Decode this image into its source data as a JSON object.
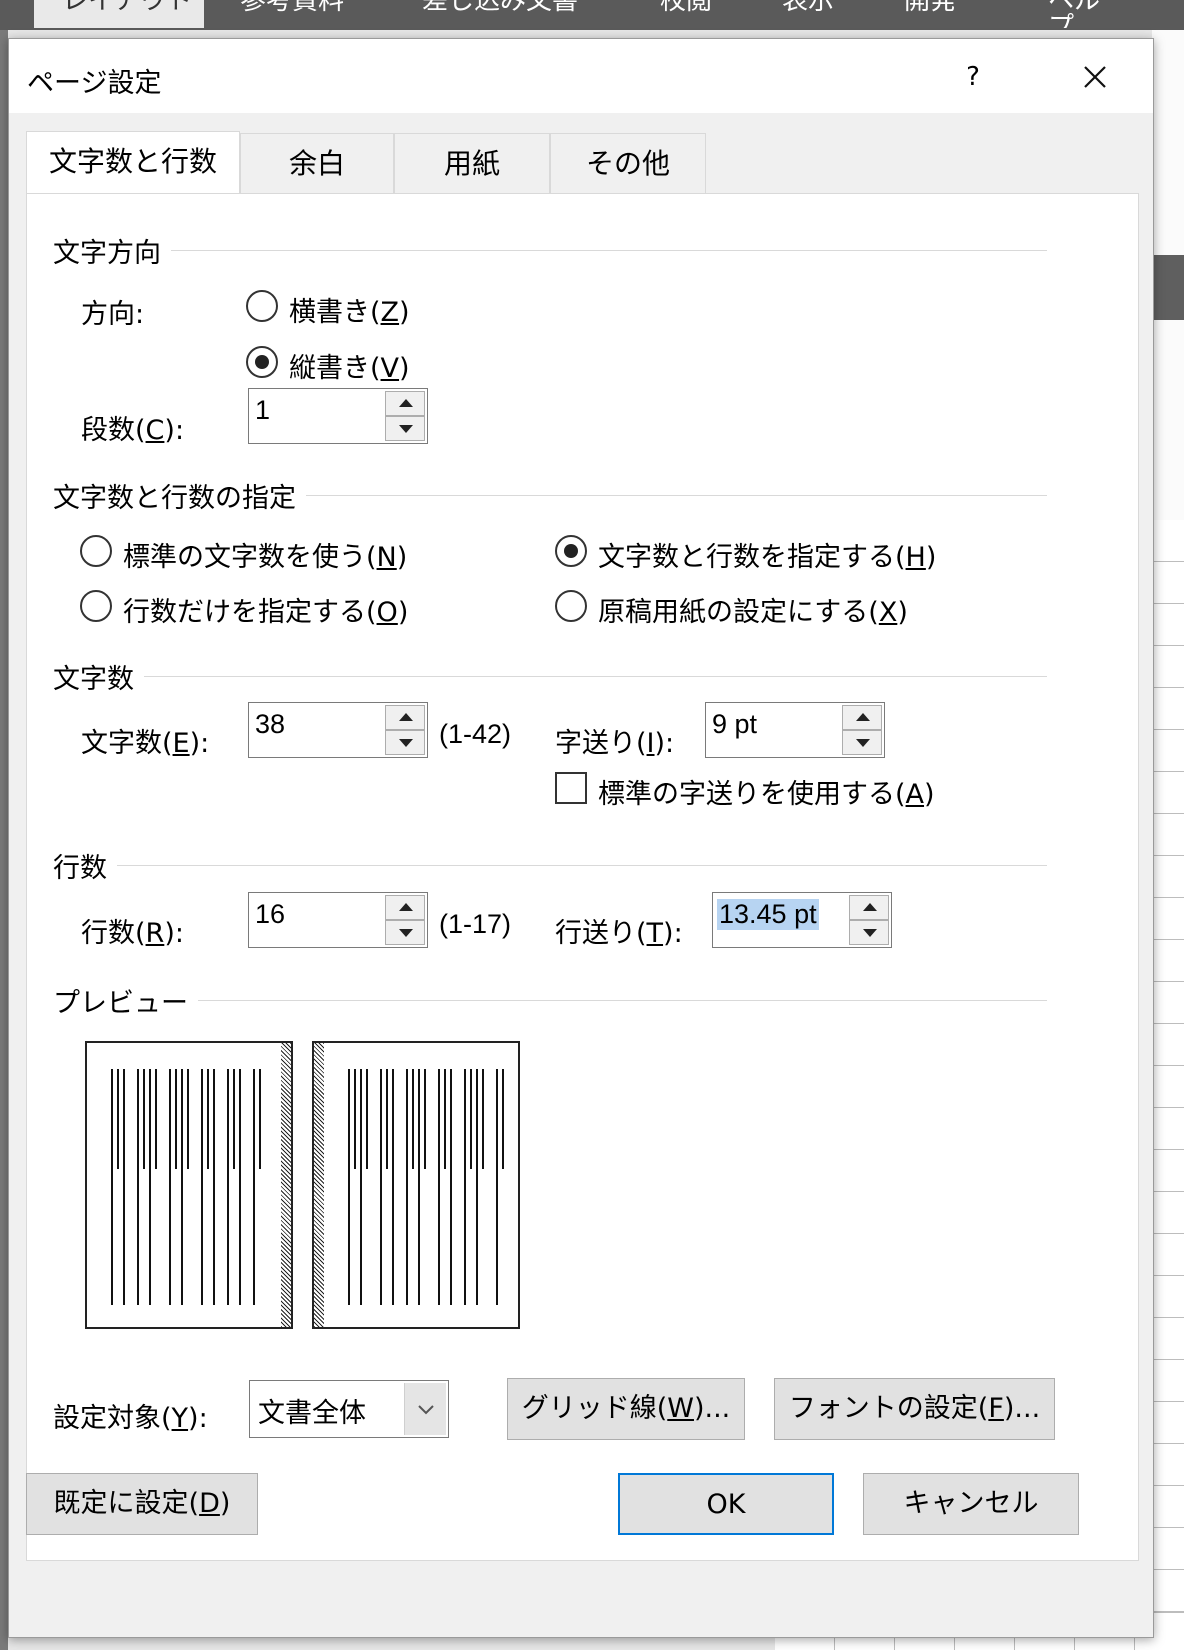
{
  "background": {
    "ribbon_tabs": [
      "レイアウト",
      "参考資料",
      "差し込み文書",
      "校閲",
      "表示",
      "開発",
      "ヘルプ"
    ]
  },
  "dialog": {
    "title": "ページ設定",
    "help": "?",
    "tabs": [
      "文字数と行数",
      "余白",
      "用紙",
      "その他"
    ],
    "active_tab": "文字数と行数"
  },
  "text_direction": {
    "group": "文字方向",
    "direction_label": "方向:",
    "horizontal": {
      "text": "横書き(",
      "key": "Z",
      "end": ")",
      "checked": false
    },
    "vertical": {
      "text": "縦書き(",
      "key": "V",
      "end": ")",
      "checked": true
    },
    "columns_label": {
      "text": "段数(",
      "key": "C",
      "end": "):"
    },
    "columns_value": "1"
  },
  "grid_spec": {
    "group": "文字数と行数の指定",
    "options": {
      "standard": {
        "text": "標準の文字数を使う(",
        "key": "N",
        "end": ")",
        "checked": false
      },
      "lines_only": {
        "text": "行数だけを指定する(",
        "key": "O",
        "end": ")",
        "checked": false
      },
      "chars_and_lines": {
        "text": "文字数と行数を指定する(",
        "key": "H",
        "end": ")",
        "checked": true
      },
      "manuscript": {
        "text": "原稿用紙の設定にする(",
        "key": "X",
        "end": ")",
        "checked": false
      }
    }
  },
  "chars": {
    "group": "文字数",
    "count_label": {
      "text": "文字数(",
      "key": "E",
      "end": "):"
    },
    "count_value": "38",
    "count_range": "(1-42)",
    "pitch_label": {
      "text": "字送り(",
      "key": "I",
      "end": "):"
    },
    "pitch_value": "9 pt",
    "use_standard": {
      "text": "標準の字送りを使用する(",
      "key": "A",
      "end": ")",
      "checked": false
    }
  },
  "lines": {
    "group": "行数",
    "count_label": {
      "text": "行数(",
      "key": "R",
      "end": "):"
    },
    "count_value": "16",
    "count_range": "(1-17)",
    "pitch_label": {
      "text": "行送り(",
      "key": "T",
      "end": "):"
    },
    "pitch_value": "13.45 pt"
  },
  "preview": {
    "group": "プレビュー"
  },
  "apply_to": {
    "label": {
      "text": "設定対象(",
      "key": "Y",
      "end": "):"
    },
    "value": "文書全体"
  },
  "buttons": {
    "grid": {
      "text": "グリッド線(",
      "key": "W",
      "end": ")..."
    },
    "font": {
      "text": "フォントの設定(",
      "key": "F",
      "end": ")..."
    },
    "default": {
      "text": "既定に設定(",
      "key": "D",
      "end": ")"
    },
    "ok": "OK",
    "cancel": "キャンセル"
  },
  "colors": {
    "accent": "#0078d7",
    "selection": "#b7d4f2"
  }
}
